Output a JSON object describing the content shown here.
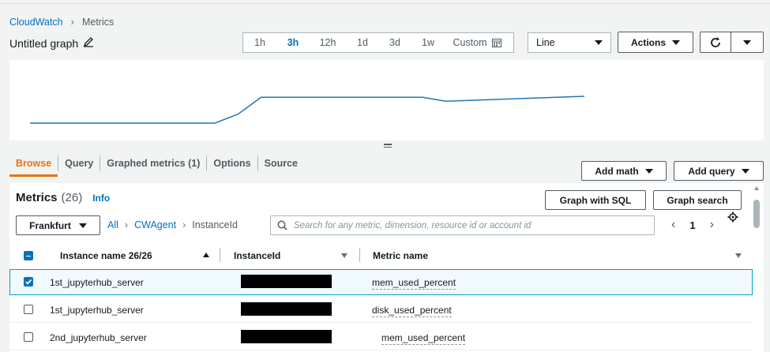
{
  "breadcrumb": {
    "root": "CloudWatch",
    "current": "Metrics"
  },
  "graph_title": "Untitled graph",
  "time_range": {
    "options": [
      "1h",
      "3h",
      "12h",
      "1d",
      "3d",
      "1w",
      "Custom"
    ],
    "active": "3h"
  },
  "chart_type": "Line",
  "actions_label": "Actions",
  "tabs": [
    "Browse",
    "Query",
    "Graphed metrics (1)",
    "Options",
    "Source"
  ],
  "add_math_label": "Add math",
  "add_query_label": "Add query",
  "metrics_header": {
    "title": "Metrics",
    "count": "(26)",
    "info": "Info"
  },
  "graph_with_sql_label": "Graph with SQL",
  "graph_search_label": "Graph search",
  "region": "Frankfurt",
  "nav": {
    "all": "All",
    "namespace": "CWAgent",
    "dimension": "InstanceId"
  },
  "search": {
    "placeholder": "Search for any metric, dimension, resource id or account id"
  },
  "pagination": {
    "page": "1"
  },
  "table": {
    "columns": [
      "Instance name 26/26",
      "InstanceId",
      "Metric name"
    ],
    "rows": [
      {
        "instance_name": "1st_jupyterhub_server",
        "metric": "mem_used_percent",
        "selected": true
      },
      {
        "instance_name": "1st_jupyterhub_server",
        "metric": "disk_used_percent",
        "selected": false
      },
      {
        "instance_name": "2nd_jupyterhub_server",
        "metric": "mem_used_percent",
        "selected": false
      }
    ]
  },
  "colors": {
    "accent": "#0073bb",
    "tab_active": "#ec7211",
    "line": "#1f77b4"
  },
  "chart_data": {
    "type": "line",
    "x": [
      0,
      8,
      16,
      18,
      20,
      34,
      36,
      48
    ],
    "values": [
      1,
      1,
      1,
      1.9,
      3.6,
      3.6,
      3.2,
      3.7
    ],
    "series": [
      {
        "values": [
          1,
          1,
          1,
          1.9,
          3.6,
          3.6,
          3.2,
          3.7
        ]
      }
    ],
    "title": "",
    "xlabel": "",
    "ylabel": "",
    "grid": false
  }
}
